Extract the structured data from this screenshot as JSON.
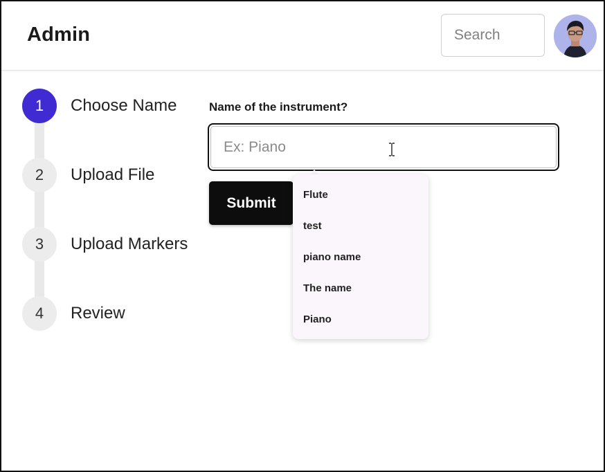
{
  "header": {
    "title": "Admin",
    "search_placeholder": "Search",
    "avatar_label": "User avatar"
  },
  "stepper": {
    "active_index": 0,
    "accent_color": "#3f2bd1",
    "steps": [
      {
        "number": "1",
        "label": "Choose Name"
      },
      {
        "number": "2",
        "label": "Upload File"
      },
      {
        "number": "3",
        "label": "Upload Markers"
      },
      {
        "number": "4",
        "label": "Review"
      }
    ]
  },
  "form": {
    "label": "Name of the instrument?",
    "input_placeholder": "Ex: Piano",
    "input_value": "",
    "submit_label": "Submit"
  },
  "suggestions": {
    "items": [
      "Flute",
      "test",
      "piano name",
      "The name",
      "Piano"
    ]
  }
}
